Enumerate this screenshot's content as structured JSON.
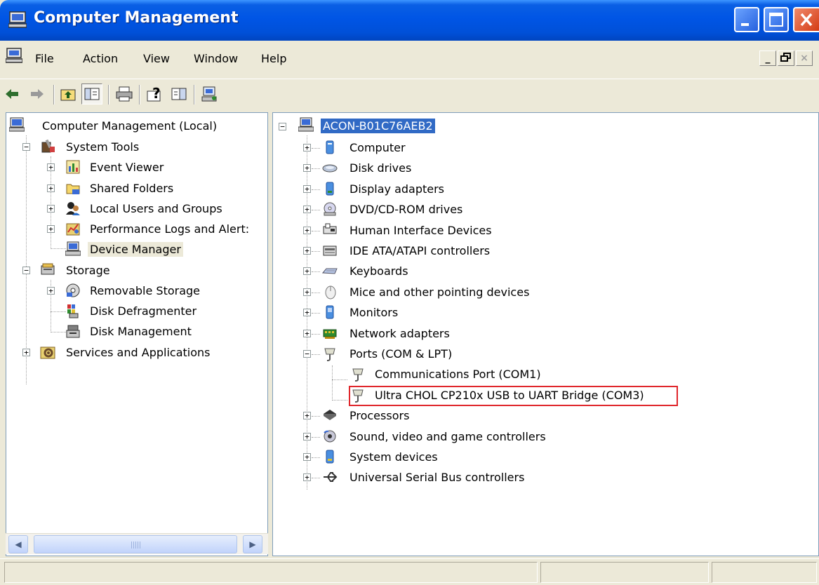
{
  "window": {
    "title": "Computer Management",
    "icon": "computer-management-icon"
  },
  "menu": {
    "items": [
      "File",
      "Action",
      "View",
      "Window",
      "Help"
    ]
  },
  "toolbar": {
    "buttons": [
      "back-arrow-icon",
      "forward-arrow-icon",
      "up-folder-icon",
      "show-hide-tree-icon",
      "print-icon",
      "help-icon",
      "properties-icon",
      "device-icon"
    ]
  },
  "left_tree": {
    "root": "Computer Management (Local)",
    "system_tools": "System Tools",
    "event_viewer": "Event Viewer",
    "shared_folders": "Shared Folders",
    "local_users": "Local Users and Groups",
    "perf_logs": "Performance Logs and Alert:",
    "device_manager": "Device Manager",
    "storage": "Storage",
    "removable_storage": "Removable Storage",
    "disk_defrag": "Disk Defragmenter",
    "disk_management": "Disk Management",
    "services": "Services and Applications"
  },
  "right_tree": {
    "root": "ACON-B01C76AEB2",
    "categories": [
      "Computer",
      "Disk drives",
      "Display adapters",
      "DVD/CD-ROM drives",
      "Human Interface Devices",
      "IDE ATA/ATAPI controllers",
      "Keyboards",
      "Mice and other pointing devices",
      "Monitors",
      "Network adapters",
      "Ports (COM & LPT)"
    ],
    "ports": [
      "Communications Port (COM1)",
      "Ultra CHOL CP210x USB to UART Bridge (COM3)"
    ],
    "categories_after": [
      "Processors",
      "Sound, video and game controllers",
      "System devices",
      "Universal Serial Bus controllers"
    ]
  },
  "colors": {
    "selection": "#316AC5",
    "highlight_box": "#E0262B",
    "titlebar": "#0055E5"
  }
}
